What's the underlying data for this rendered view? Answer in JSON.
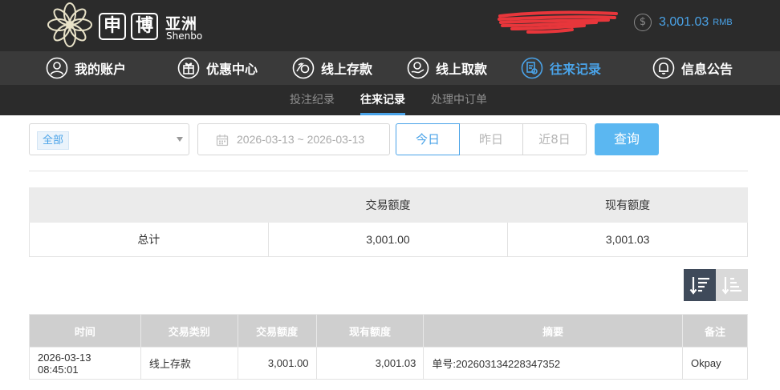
{
  "header": {
    "logo_char1": "申",
    "logo_char2": "博",
    "logo_cn": "亚洲",
    "logo_en": "Shenbo",
    "balance_amount": "3,001.03",
    "balance_currency": "RMB",
    "colors": {
      "accent": "#4aa3e8",
      "header_bg": "#2b2b2b",
      "nav_bg": "#3a3a3a"
    }
  },
  "nav": {
    "items": [
      {
        "label": "我的账户",
        "icon": "user-icon"
      },
      {
        "label": "优惠中心",
        "icon": "gift-icon"
      },
      {
        "label": "线上存款",
        "icon": "deposit-icon"
      },
      {
        "label": "线上取款",
        "icon": "withdraw-icon"
      },
      {
        "label": "往来记录",
        "icon": "records-icon",
        "active": true
      },
      {
        "label": "信息公告",
        "icon": "bell-icon"
      }
    ]
  },
  "subnav": {
    "items": [
      {
        "label": "投注纪录"
      },
      {
        "label": "往来记录",
        "active": true
      },
      {
        "label": "处理中订单"
      }
    ]
  },
  "filters": {
    "type_selected": "全部",
    "date_range": "2026-03-13 ~ 2026-03-13",
    "today": "今日",
    "yesterday": "昨日",
    "last8": "近8日",
    "query_label": "查询"
  },
  "summary": {
    "headers": [
      "",
      "交易额度",
      "现有额度"
    ],
    "row_label": "总计",
    "trade_amount": "3,001.00",
    "current_amount": "3,001.03"
  },
  "table": {
    "headers": [
      "时间",
      "交易类别",
      "交易额度",
      "现有额度",
      "摘要",
      "备注"
    ],
    "rows": [
      {
        "time": "2026-03-13 08:45:01",
        "type": "线上存款",
        "amount": "3,001.00",
        "balance": "3,001.03",
        "summary": "单号:202603134228347352",
        "note": "Okpay"
      }
    ]
  }
}
